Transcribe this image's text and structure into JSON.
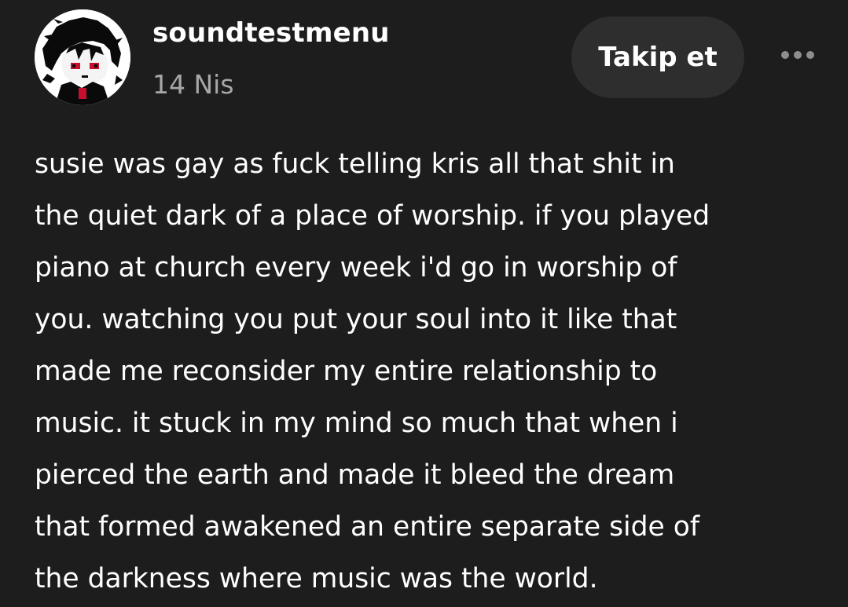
{
  "post": {
    "author": {
      "username": "soundtestmenu",
      "date": "14 Nis",
      "avatar_icon": "pixel-character-avatar"
    },
    "follow_label": "Takip et",
    "more_icon": "more-options-icon",
    "body_lines": [
      "susie was gay as fuck telling kris all that shit in",
      "the quiet dark of a place of worship. if you played",
      "piano at church every week i'd go in worship of",
      "you. watching you put your soul into it like that",
      "made me reconsider my entire relationship to",
      "music. it stuck in my mind so much that when i",
      "pierced the earth and made it bleed the dream",
      "that formed awakened an entire separate side of",
      "the darkness where music was the world."
    ]
  },
  "colors": {
    "background": "#1d1d1d",
    "button_background": "#2e2e2e",
    "text_primary": "#ffffff",
    "text_secondary": "#a7a7a7",
    "avatar_accent": "#c8102e"
  }
}
